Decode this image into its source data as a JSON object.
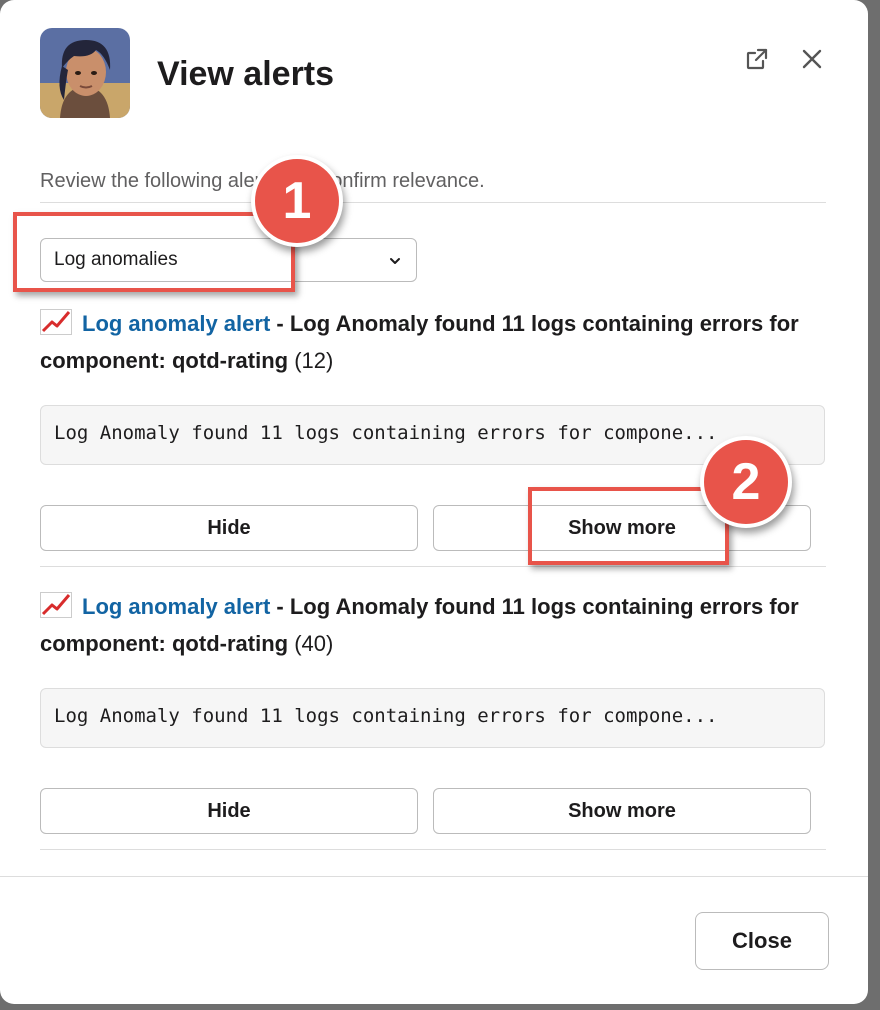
{
  "modal": {
    "title": "View alerts",
    "subtitle": "Review the following alerts and confirm relevance.",
    "filter": {
      "selected": "Log anomalies"
    },
    "alerts": [
      {
        "link_text": "Log anomaly alert",
        "description": " - Log Anomaly found 11 logs containing errors for component: qotd-rating",
        "count": " (12)",
        "preview": "Log Anomaly found 11 logs containing errors for compone...",
        "hide_label": "Hide",
        "show_more_label": "Show more"
      },
      {
        "link_text": "Log anomaly alert",
        "description": " - Log Anomaly found 11 logs containing errors for component: qotd-rating",
        "count": " (40)",
        "preview": "Log Anomaly found 11 logs containing errors for compone...",
        "hide_label": "Hide",
        "show_more_label": "Show more"
      }
    ],
    "close_label": "Close",
    "icons": {
      "external": "external-link-icon",
      "close": "close-icon",
      "alert": "chart-increasing-icon",
      "chevron": "chevron-down-icon"
    }
  },
  "callouts": [
    {
      "number": "1"
    },
    {
      "number": "2"
    }
  ],
  "colors": {
    "link": "#1264a3",
    "callout": "#e8544a",
    "backdrop": "#6e6e6e"
  }
}
